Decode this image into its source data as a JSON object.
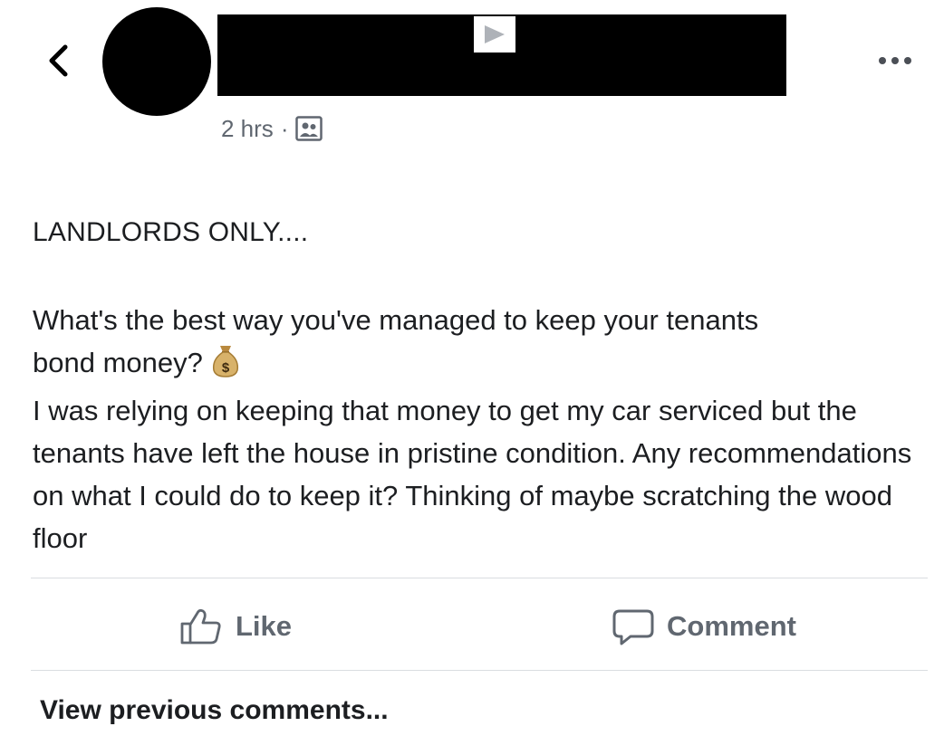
{
  "header": {
    "timestamp": "2 hrs",
    "separator": "·",
    "audience_icon": "group-icon"
  },
  "post": {
    "title": "LANDLORDS ONLY....",
    "question_line1": "What's the best way you've managed to keep your tenants",
    "question_line2": "bond money?",
    "emoji": "money-bag-icon",
    "body": "I was relying on keeping that money to get my car serviced but the tenants have left the house in pristine condition. Any recommendations on what I could do to keep it? Thinking of maybe scratching the wood floor"
  },
  "actions": {
    "like_label": "Like",
    "comment_label": "Comment"
  },
  "comments": {
    "view_previous_label": "View previous comments..."
  },
  "colors": {
    "secondary_text": "#606770",
    "primary_text": "#1c1e21",
    "divider": "#dadde1"
  }
}
